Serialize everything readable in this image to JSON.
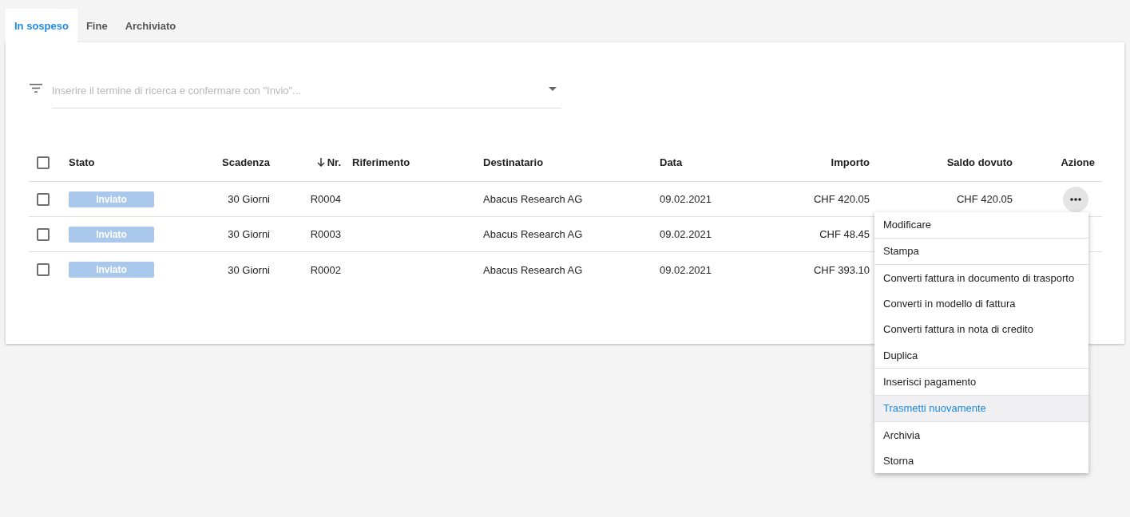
{
  "tabs": [
    {
      "label": "In sospeso",
      "selected": true
    },
    {
      "label": "Fine",
      "selected": false
    },
    {
      "label": "Archiviato",
      "selected": false
    }
  ],
  "search": {
    "placeholder": "Inserire il termine di ricerca e confermare con \"Invio\"..."
  },
  "table": {
    "select_all": {
      "checked": false
    },
    "columns": [
      {
        "label": "Stato",
        "sorted": false
      },
      {
        "label": "Scadenza",
        "sorted": false
      },
      {
        "label": "Nr.",
        "sorted": true
      },
      {
        "label": "Riferimento",
        "sorted": false
      },
      {
        "label": "Destinatario",
        "sorted": false
      },
      {
        "label": "Data",
        "sorted": false
      },
      {
        "label": "Importo",
        "sorted": false
      },
      {
        "label": "Saldo dovuto",
        "sorted": false
      },
      {
        "label": "Azione",
        "sorted": false
      }
    ],
    "rows": [
      {
        "checked": false,
        "stato": "Inviato",
        "scadenza": "30 Giorni",
        "nr": "R0004",
        "destinatario": "Abacus Research AG",
        "data": "09.02.2021",
        "importo": "CHF 420.05",
        "saldo_dovuto": "CHF 420.05",
        "menu_open": true
      },
      {
        "checked": false,
        "stato": "Inviato",
        "scadenza": "30 Giorni",
        "nr": "R0003",
        "destinatario": "Abacus Research AG",
        "data": "09.02.2021",
        "importo": "CHF 48.45"
      },
      {
        "checked": false,
        "stato": "Inviato",
        "scadenza": "30 Giorni",
        "nr": "R0002",
        "destinatario": "Abacus Research AG",
        "data": "09.02.2021",
        "importo": "CHF 393.10"
      }
    ]
  },
  "action_menu": {
    "groups": [
      {
        "items": [
          {
            "label": "Modificare",
            "highlighted": false
          }
        ]
      },
      {
        "items": [
          {
            "label": "Stampa",
            "highlighted": false
          }
        ]
      },
      {
        "items": [
          {
            "label": "Converti fattura in documento di trasporto",
            "highlighted": false
          },
          {
            "label": "Converti in modello di fattura",
            "highlighted": false
          },
          {
            "label": "Converti fattura in nota di credito",
            "highlighted": false
          },
          {
            "label": "Duplica",
            "highlighted": false
          }
        ]
      },
      {
        "items": [
          {
            "label": "Inserisci pagamento",
            "highlighted": false
          }
        ]
      },
      {
        "items": [
          {
            "label": "Trasmetti nuovamente",
            "highlighted": true
          }
        ]
      },
      {
        "items": [
          {
            "label": "Archivia",
            "highlighted": false
          },
          {
            "label": "Storna",
            "highlighted": false
          }
        ]
      }
    ]
  }
}
